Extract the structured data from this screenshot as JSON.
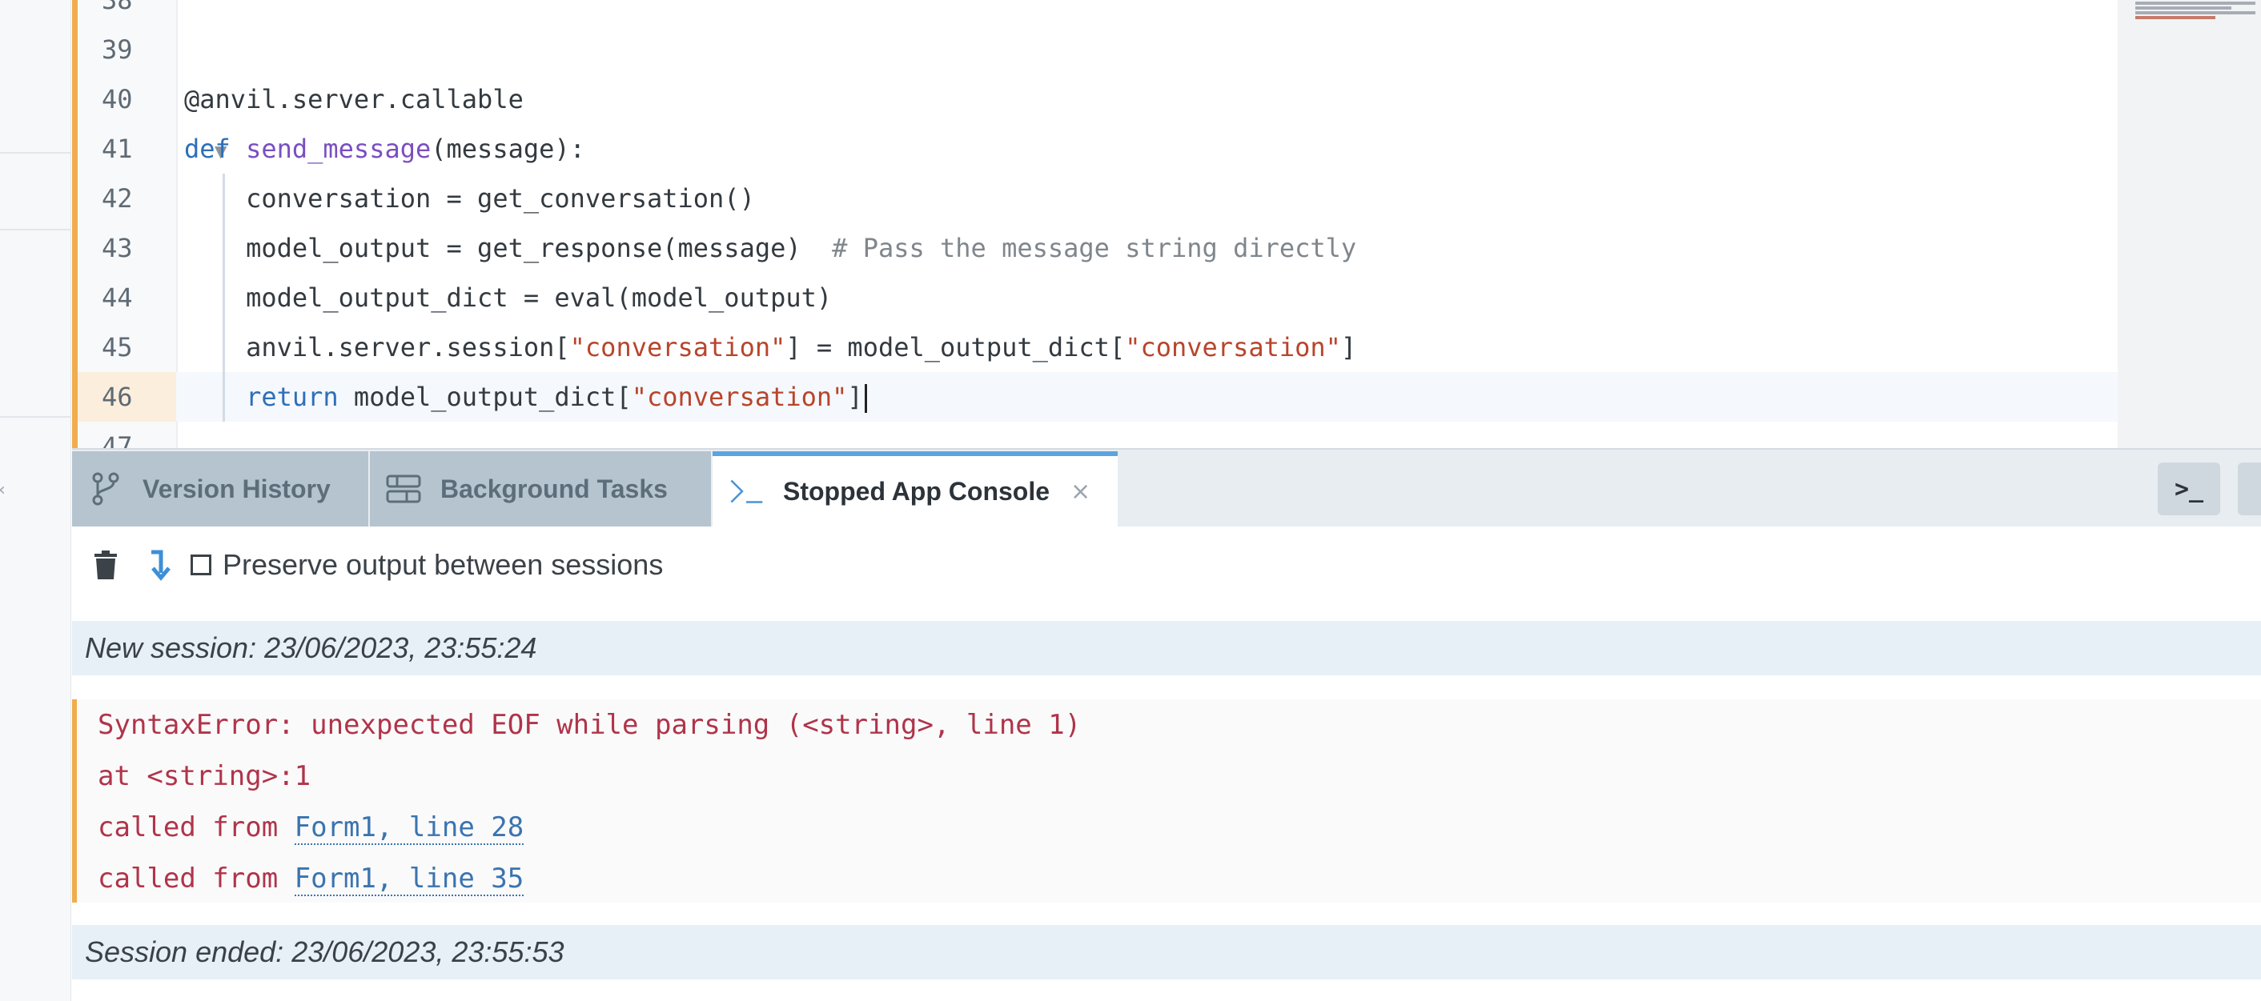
{
  "editor": {
    "lines": [
      {
        "num": "38",
        "tokens": []
      },
      {
        "num": "39",
        "tokens": []
      },
      {
        "num": "40",
        "tokens": [
          {
            "t": "@anvil.server.callable",
            "c": ""
          }
        ]
      },
      {
        "num": "41",
        "fold": true,
        "tokens": [
          {
            "t": "def ",
            "c": "kw"
          },
          {
            "t": "send_message",
            "c": "fn"
          },
          {
            "t": "(message):",
            "c": ""
          }
        ]
      },
      {
        "num": "42",
        "indent": true,
        "tokens": [
          {
            "t": "    conversation = get_conversation()",
            "c": ""
          }
        ]
      },
      {
        "num": "43",
        "indent": true,
        "tokens": [
          {
            "t": "    model_output = get_response(message)  ",
            "c": ""
          },
          {
            "t": "# Pass the message string directly",
            "c": "cm"
          }
        ]
      },
      {
        "num": "44",
        "indent": true,
        "tokens": [
          {
            "t": "    model_output_dict = eval(model_output)",
            "c": ""
          }
        ]
      },
      {
        "num": "45",
        "indent": true,
        "tokens": [
          {
            "t": "    anvil.server.session[",
            "c": ""
          },
          {
            "t": "\"conversation\"",
            "c": "str"
          },
          {
            "t": "] = model_output_dict[",
            "c": ""
          },
          {
            "t": "\"conversation\"",
            "c": "str"
          },
          {
            "t": "]",
            "c": ""
          }
        ]
      },
      {
        "num": "46",
        "indent": true,
        "current": true,
        "tokens": [
          {
            "t": "    ",
            "c": ""
          },
          {
            "t": "return",
            "c": "kw"
          },
          {
            "t": " model_output_dict[",
            "c": ""
          },
          {
            "t": "\"conversation\"",
            "c": "str"
          },
          {
            "t": "]",
            "c": ""
          }
        ]
      },
      {
        "num": "47",
        "tokens": []
      }
    ]
  },
  "tabs": {
    "version_history": "Version History",
    "background_tasks": "Background Tasks",
    "stopped_app_console": "Stopped App Console",
    "close_glyph": "×",
    "terminal_glyph": ">_"
  },
  "console": {
    "preserve_label": "Preserve output between sessions",
    "session_start": "New session: 23/06/2023, 23:55:24",
    "error": {
      "message": "SyntaxError: unexpected EOF while parsing (<string>, line 1)",
      "at": "at <string>:1",
      "called_prefix": "called from ",
      "calls": [
        "Form1, line 28",
        "Form1, line 35"
      ]
    },
    "session_end": "Session ended: 23/06/2023, 23:55:53"
  },
  "colors": {
    "accent_orange": "#f0ad4e",
    "active_tab_top": "#5ba4e0",
    "error_red": "#b0344a",
    "link_blue": "#3a74b0"
  }
}
